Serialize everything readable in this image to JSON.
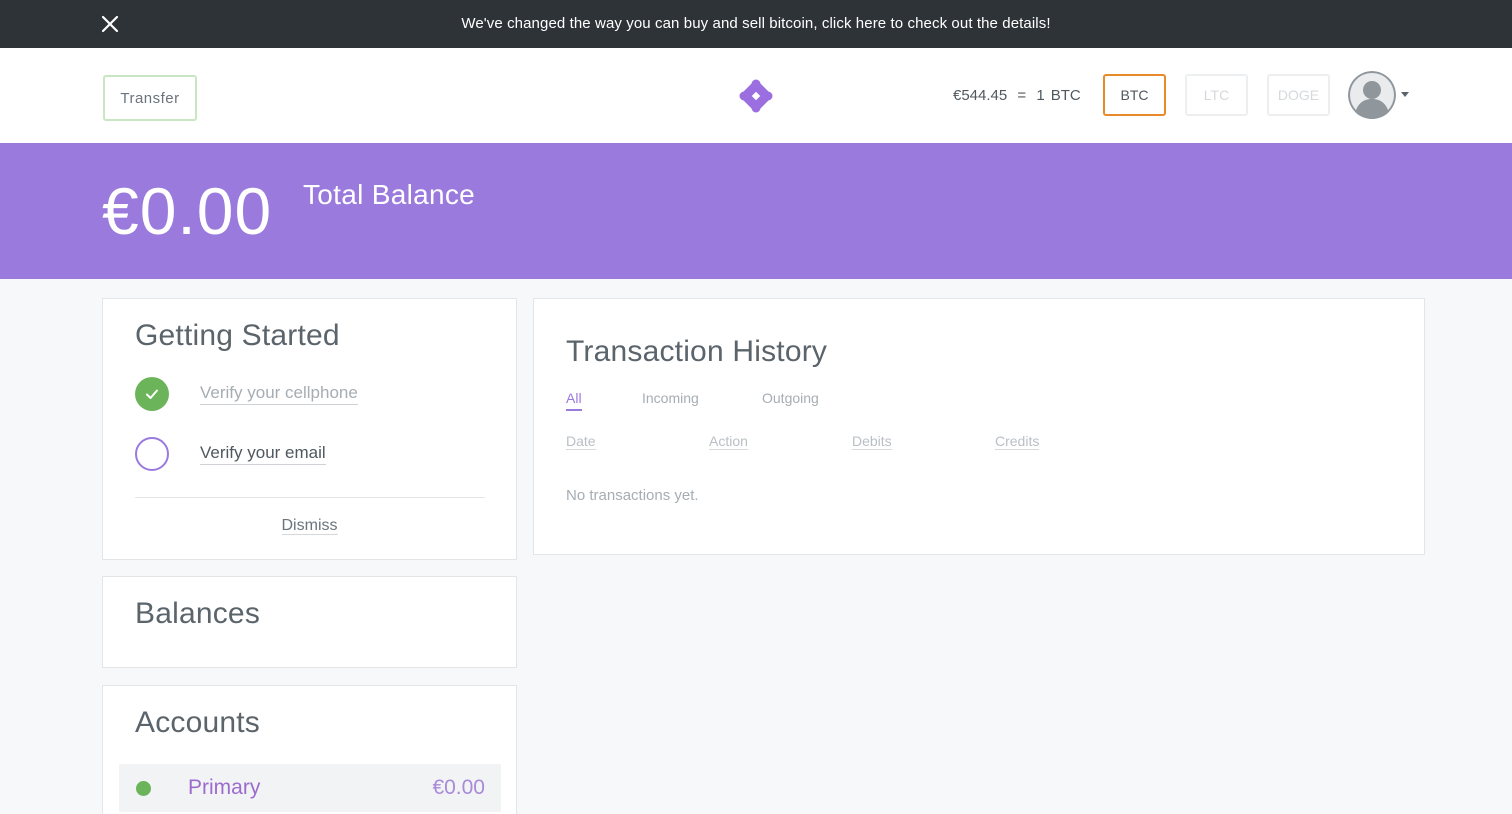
{
  "announcement": {
    "message": "We've changed the way you can buy and sell bitcoin, click here to check out the details!",
    "close_icon": "close-icon"
  },
  "header": {
    "transfer_label": "Transfer",
    "logo_icon": "diamond-logo-icon",
    "rate": {
      "fiat": "€544.45",
      "equals": "=",
      "crypto_amount": "1",
      "crypto_code": "BTC"
    },
    "currencies": [
      {
        "label": "BTC",
        "active": true
      },
      {
        "label": "LTC",
        "active": false
      },
      {
        "label": "DOGE",
        "active": false
      }
    ],
    "avatar_icon": "user-avatar-icon",
    "menu_icon": "caret-down-icon"
  },
  "hero": {
    "total_amount": "€0.00",
    "total_label": "Total Balance"
  },
  "getting_started": {
    "title": "Getting Started",
    "tasks": [
      {
        "label": "Verify your cellphone",
        "done": true
      },
      {
        "label": "Verify your email",
        "done": false
      }
    ],
    "dismiss_label": "Dismiss"
  },
  "balances": {
    "title": "Balances"
  },
  "accounts": {
    "title": "Accounts",
    "items": [
      {
        "name": "Primary",
        "balance": "€0.00"
      }
    ]
  },
  "transaction_history": {
    "title": "Transaction History",
    "tabs": [
      {
        "label": "All",
        "active": true
      },
      {
        "label": "Incoming",
        "active": false
      },
      {
        "label": "Outgoing",
        "active": false
      }
    ],
    "columns": [
      "Date",
      "Action",
      "Debits",
      "Credits"
    ],
    "empty_text": "No transactions yet."
  },
  "colors": {
    "brand_purple": "#9b7ade",
    "success_green": "#6cb45a",
    "active_orange": "#e98a2a",
    "dark_bar": "#2e3338"
  }
}
